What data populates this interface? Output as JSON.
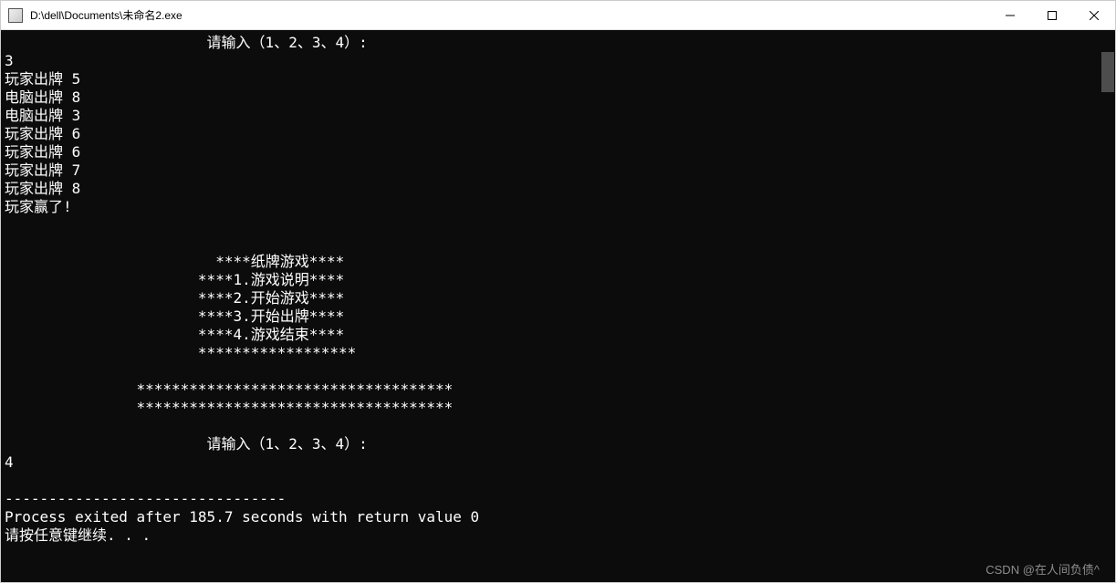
{
  "window": {
    "title": "D:\\dell\\Documents\\未命名2.exe"
  },
  "console": {
    "lines": [
      "                       请输入（1、2、3、4）:",
      "3",
      "玩家出牌 5",
      "电脑出牌 8",
      "电脑出牌 3",
      "玩家出牌 6",
      "玩家出牌 6",
      "玩家出牌 7",
      "玩家出牌 8",
      "玩家赢了!",
      "",
      "",
      "                        ****纸牌游戏****",
      "                      ****1.游戏说明****",
      "                      ****2.开始游戏****",
      "                      ****3.开始出牌****",
      "                      ****4.游戏结束****",
      "                      ******************",
      "",
      "               ************************************",
      "               ************************************",
      "",
      "                       请输入（1、2、3、4）:",
      "4",
      "",
      "--------------------------------",
      "Process exited after 185.7 seconds with return value 0",
      "请按任意键继续. . ."
    ]
  },
  "watermark": {
    "text": "CSDN @在人间负债^"
  }
}
